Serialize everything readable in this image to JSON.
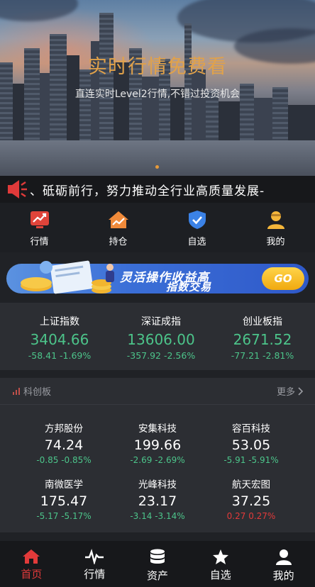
{
  "hero": {
    "title": "实时行情免费看",
    "subtitle": "直连实时Level2行情,不错过投资机会"
  },
  "marquee": {
    "text": "、砥砺前行，努力推动全行业高质量发展-"
  },
  "quicknav": [
    {
      "label": "行情",
      "icon": "trend-chart-icon"
    },
    {
      "label": "持仓",
      "icon": "house-chart-icon"
    },
    {
      "label": "自选",
      "icon": "shield-check-icon"
    },
    {
      "label": "我的",
      "icon": "user-icon"
    }
  ],
  "ad": {
    "line1": "灵活操作收益高",
    "line2": "指数交易",
    "button": "GO"
  },
  "indices": [
    {
      "name": "上证指数",
      "value": "3404.66",
      "change": "-58.41 -1.69%"
    },
    {
      "name": "深证成指",
      "value": "13606.00",
      "change": "-357.92 -2.56%"
    },
    {
      "name": "创业板指",
      "value": "2671.52",
      "change": "-77.21 -2.81%"
    }
  ],
  "star_market": {
    "title": "科创板",
    "more": "更多",
    "stocks": [
      {
        "name": "方邦股份",
        "price": "74.24",
        "change": "-0.85 -0.85%",
        "direction": "down"
      },
      {
        "name": "安集科技",
        "price": "199.66",
        "change": "-2.69 -2.69%",
        "direction": "down"
      },
      {
        "name": "容百科技",
        "price": "53.05",
        "change": "-5.91 -5.91%",
        "direction": "down"
      },
      {
        "name": "南微医学",
        "price": "175.47",
        "change": "-5.17 -5.17%",
        "direction": "down"
      },
      {
        "name": "光峰科技",
        "price": "23.17",
        "change": "-3.14 -3.14%",
        "direction": "down"
      },
      {
        "name": "航天宏图",
        "price": "37.25",
        "change": "0.27 0.27%",
        "direction": "up"
      }
    ]
  },
  "tabbar": [
    {
      "label": "首页",
      "icon": "home-icon",
      "active": true
    },
    {
      "label": "行情",
      "icon": "pulse-icon",
      "active": false
    },
    {
      "label": "资产",
      "icon": "database-icon",
      "active": false
    },
    {
      "label": "自选",
      "icon": "star-icon",
      "active": false
    },
    {
      "label": "我的",
      "icon": "person-icon",
      "active": false
    }
  ],
  "colors": {
    "up": "#e23a3a",
    "down": "#4cc48a",
    "accent": "#e1a24a",
    "background": "#202226",
    "card": "#2c2e33"
  }
}
